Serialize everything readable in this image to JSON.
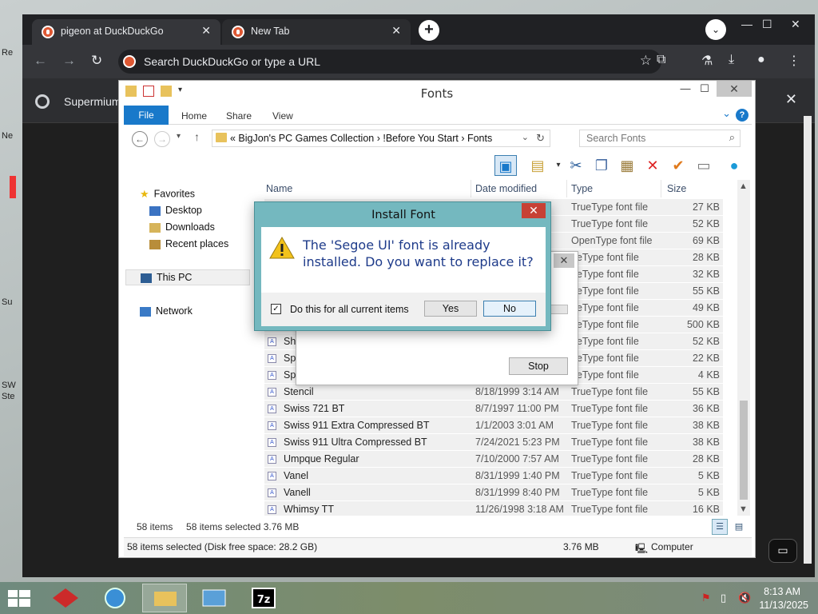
{
  "browser": {
    "tabs": [
      {
        "label": "pigeon at DuckDuckGo",
        "close": "✕"
      },
      {
        "label": "New Tab",
        "close": "✕"
      }
    ],
    "new_tab": "+",
    "tab_search": "⌄",
    "window_controls": {
      "minimize": "—",
      "maximize": "☐",
      "close": "✕"
    },
    "omnibox_placeholder": "Search DuckDuckGo or type a URL",
    "infobar_text": "Supermium",
    "infobar_close": "✕"
  },
  "explorer": {
    "title": "Fonts",
    "controls": {
      "minimize": "—",
      "maximize": "☐",
      "close": "✕"
    },
    "ribbon_tabs": [
      "File",
      "Home",
      "Share",
      "View"
    ],
    "address_path": "«   BigJon's PC Games Collection  ›  !Before You Start  ›  Fonts",
    "search_placeholder": "Search Fonts",
    "nav": {
      "favorites": "Favorites",
      "desktop": "Desktop",
      "downloads": "Downloads",
      "recent": "Recent places",
      "this_pc": "This PC",
      "network": "Network"
    },
    "columns": [
      "Name",
      "Date modified",
      "Type",
      "Size"
    ],
    "rows": [
      {
        "name": "",
        "date": "",
        "type": "TrueType font file",
        "size": "27 KB"
      },
      {
        "name": "",
        "date": "",
        "type": "TrueType font file",
        "size": "52 KB"
      },
      {
        "name": "",
        "date": "M",
        "type": "OpenType font file",
        "size": "69 KB"
      },
      {
        "name": "",
        "date": "",
        "type": "ueType font file",
        "size": "28 KB"
      },
      {
        "name": "",
        "date": "",
        "type": "ueType font file",
        "size": "32 KB"
      },
      {
        "name": "",
        "date": "",
        "type": "ueType font file",
        "size": "55 KB"
      },
      {
        "name": "",
        "date": "",
        "type": "ueType font file",
        "size": "49 KB"
      },
      {
        "name": "",
        "date": "",
        "type": "ueType font file",
        "size": "500 KB"
      },
      {
        "name": "Sh",
        "date": "",
        "type": "ueType font file",
        "size": "52 KB"
      },
      {
        "name": "Sp",
        "date": "",
        "type": "ueType font file",
        "size": "22 KB"
      },
      {
        "name": "Sp",
        "date": "",
        "type": "ueType font file",
        "size": "4 KB"
      },
      {
        "name": "Stencil",
        "date": "8/18/1999 3:14 AM",
        "type": "TrueType font file",
        "size": "55 KB"
      },
      {
        "name": "Swiss 721 BT",
        "date": "8/7/1997 11:00 PM",
        "type": "TrueType font file",
        "size": "36 KB"
      },
      {
        "name": "Swiss 911 Extra Compressed BT",
        "date": "1/1/2003 3:01 AM",
        "type": "TrueType font file",
        "size": "38 KB"
      },
      {
        "name": "Swiss 911 Ultra Compressed BT",
        "date": "7/24/2021 5:23 PM",
        "type": "TrueType font file",
        "size": "38 KB"
      },
      {
        "name": "Umpque Regular",
        "date": "7/10/2000 7:57 AM",
        "type": "TrueType font file",
        "size": "28 KB"
      },
      {
        "name": "Vanel",
        "date": "8/31/1999 1:40 PM",
        "type": "TrueType font file",
        "size": "5 KB"
      },
      {
        "name": "Vanell",
        "date": "8/31/1999 8:40 PM",
        "type": "TrueType font file",
        "size": "5 KB"
      },
      {
        "name": "Whimsy TT",
        "date": "11/26/1998 3:18 AM",
        "type": "TrueType font file",
        "size": "16 KB"
      }
    ],
    "status_items": "58 items",
    "status_selected": "58 items selected  3.76 MB",
    "details_left": "58 items selected (Disk free space: 28.2 GB)",
    "details_size": "3.76 MB",
    "details_location": "Computer"
  },
  "progress_dialog": {
    "close": "✕",
    "stop_label": "Stop"
  },
  "install_dialog": {
    "title": "Install Font",
    "close": "✕",
    "message": "The 'Segoe UI' font is already installed. Do you want to replace it?",
    "checkbox_label": "Do this for all current items",
    "checkbox_checked": true,
    "yes_label": "Yes",
    "no_label": "No"
  },
  "taskbar": {
    "time": "8:13 AM",
    "date": "11/13/2025"
  },
  "desktop_labels": [
    "Re",
    "Ne",
    "Su",
    "SW",
    "Ste"
  ]
}
